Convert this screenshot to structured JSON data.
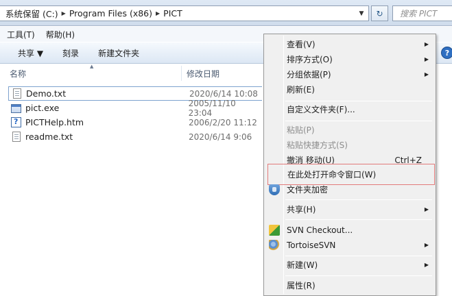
{
  "address": {
    "crumbs": [
      "系统保留 (C:)",
      "Program Files (x86)",
      "PICT"
    ],
    "search_placeholder": "搜索 PICT"
  },
  "menubar": {
    "tools": "工具(T)",
    "help": "帮助(H)"
  },
  "toolbar": {
    "share": "共享 ▼",
    "burn": "刻录",
    "new_folder": "新建文件夹",
    "help_glyph": "?"
  },
  "columns": {
    "name": "名称",
    "modified": "修改日期"
  },
  "files": [
    {
      "name": "Demo.txt",
      "date": "2020/6/14 10:08",
      "icon": "text-file-icon"
    },
    {
      "name": "pict.exe",
      "date": "2005/11/10 23:04",
      "icon": "exe-file-icon"
    },
    {
      "name": "PICTHelp.htm",
      "date": "2006/2/20 11:12",
      "icon": "help-file-icon"
    },
    {
      "name": "readme.txt",
      "date": "2020/6/14 9:06",
      "icon": "text-file-icon"
    }
  ],
  "context_menu": {
    "view": "查看(V)",
    "sort": "排序方式(O)",
    "group": "分组依据(P)",
    "refresh": "刷新(E)",
    "customize": "自定义文件夹(F)...",
    "paste": "粘贴(P)",
    "paste_shortcut": "粘贴快捷方式(S)",
    "undo": "撤消 移动(U)",
    "undo_shortcut": "Ctrl+Z",
    "open_cmd": "在此处打开命令窗口(W)",
    "encrypt": "文件夹加密",
    "share": "共享(H)",
    "svn_checkout": "SVN Checkout...",
    "tortoise": "TortoiseSVN",
    "new": "新建(W)",
    "properties": "属性(R)"
  }
}
